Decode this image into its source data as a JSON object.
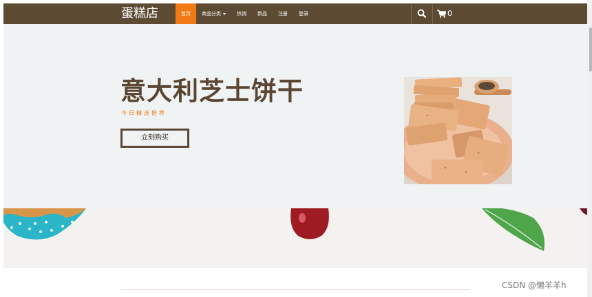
{
  "brand": "蛋糕店",
  "nav": {
    "items": [
      "首页",
      "商品分类",
      "热销",
      "新品",
      "注册",
      "登录"
    ],
    "cart_count": "0"
  },
  "hero": {
    "title": "意大利芝士饼干",
    "subtitle": "今日精选推荐",
    "button": "立刻购买"
  },
  "watermark": "CSDN @懒羊羊h",
  "colors": {
    "navbar": "#5c4a33",
    "accent": "#f07a14",
    "hero_bg": "#f0f3f4",
    "title": "#5a4632"
  }
}
